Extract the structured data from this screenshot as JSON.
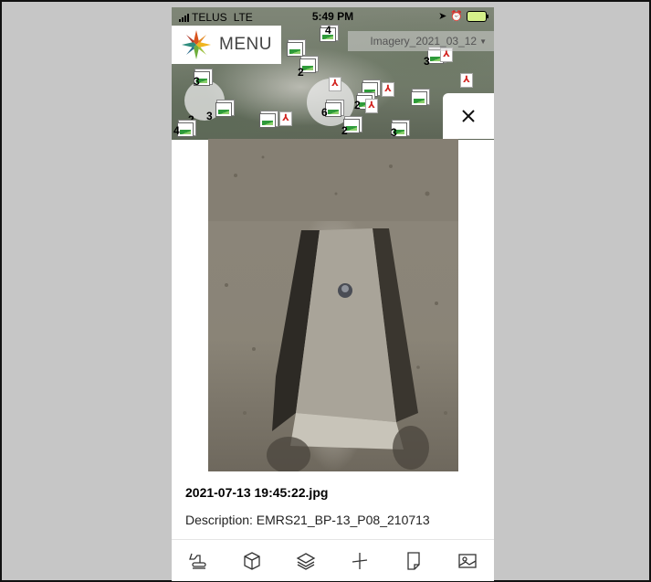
{
  "status_bar": {
    "carrier": "TELUS",
    "network": "LTE",
    "time": "5:49 PM"
  },
  "header": {
    "menu_label": "MENU",
    "layer_select_value": "Imagery_2021_03_12"
  },
  "map": {
    "cluster_counts": [
      "4",
      "2",
      "3",
      "2",
      "3",
      "6",
      "2",
      "3",
      "2",
      "4",
      "3"
    ]
  },
  "viewer": {
    "close_icon": "close-icon",
    "photo_filename": "2021-07-13 19:45:22.jpg",
    "description": "Description: EMRS21_BP-13_P08_210713"
  },
  "toolbar": {
    "items": [
      {
        "name": "excavator-tool",
        "icon": "excavator-icon"
      },
      {
        "name": "3d-tool",
        "icon": "cube-icon"
      },
      {
        "name": "layers-tool",
        "icon": "layers-icon"
      },
      {
        "name": "measure-tool",
        "icon": "measure-icon"
      },
      {
        "name": "document-tool",
        "icon": "document-icon"
      },
      {
        "name": "photo-tool",
        "icon": "image-icon"
      }
    ]
  }
}
